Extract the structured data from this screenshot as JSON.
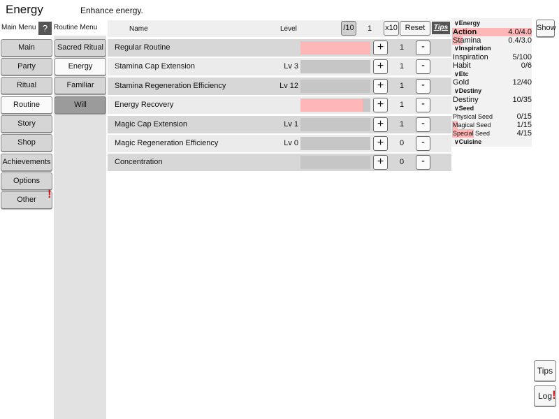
{
  "page": {
    "title": "Energy",
    "description": "Enhance energy."
  },
  "main_menu": {
    "heading": "Main Menu",
    "help": "?",
    "items": [
      {
        "label": "Main"
      },
      {
        "label": "Party"
      },
      {
        "label": "Ritual"
      },
      {
        "label": "Routine"
      },
      {
        "label": "Story"
      },
      {
        "label": "Shop"
      },
      {
        "label": "Achievements"
      },
      {
        "label": "Options"
      },
      {
        "label": "Other"
      }
    ],
    "active": "Routine",
    "alert": "!"
  },
  "routine_menu": {
    "heading": "Routine Menu",
    "items": [
      {
        "label": "Sacred Ritual"
      },
      {
        "label": "Energy"
      },
      {
        "label": "Familiar"
      },
      {
        "label": "Will"
      }
    ]
  },
  "table": {
    "col_name": "Name",
    "col_level": "Level",
    "div10": "/10",
    "multiplier": "1",
    "x10": "x10",
    "reset": "Reset",
    "tips": "Tips",
    "rows": [
      {
        "name": "Regular Routine",
        "level": "",
        "progress": 1.0,
        "plus": "+",
        "count": "1",
        "minus": "-"
      },
      {
        "name": "Stamina Cap Extension",
        "level": "Lv 3",
        "progress": 0,
        "plus": "+",
        "count": "1",
        "minus": "-"
      },
      {
        "name": "Stamina Regeneration Efficiency",
        "level": "Lv 12",
        "progress": 0,
        "plus": "+",
        "count": "1",
        "minus": "-"
      },
      {
        "name": "Energy Recovery",
        "level": "",
        "progress": 0.89,
        "plus": "+",
        "count": "1",
        "minus": "-"
      },
      {
        "name": "Magic Cap Extension",
        "level": "Lv 1",
        "progress": 0,
        "plus": "+",
        "count": "1",
        "minus": "-"
      },
      {
        "name": "Magic Regeneration Efficiency",
        "level": "Lv 0",
        "progress": 0,
        "plus": "+",
        "count": "0",
        "minus": "-"
      },
      {
        "name": "Concentration",
        "level": "",
        "progress": 0,
        "plus": "+",
        "count": "0",
        "minus": "-"
      }
    ]
  },
  "resources": {
    "groups": {
      "energy": "Energy",
      "inspiration": "Inspiration",
      "etc": "Etc",
      "destiny": "Destiny",
      "seed": "Seed",
      "cuisine": "Cuisine"
    },
    "items": {
      "action": {
        "name": "Action",
        "value": "4.0/4.0",
        "fill": 1.0
      },
      "stamina": {
        "name": "Stamina",
        "value": "0.4/3.0",
        "fill": 0.13
      },
      "inspiration": {
        "name": "Inspiration",
        "value": "5/100",
        "fill": 0
      },
      "habit": {
        "name": "Habit",
        "value": "0/6",
        "fill": 0
      },
      "gold": {
        "name": "Gold",
        "value": "12/40",
        "fill": 0
      },
      "destiny": {
        "name": "Destiny",
        "value": "10/35",
        "fill": 0
      },
      "physical_seed": {
        "name": "Physical Seed",
        "value": "0/15",
        "fill": 0
      },
      "magical_seed": {
        "name": "Magical Seed",
        "value": "1/15",
        "fill": 0.07
      },
      "special_seed": {
        "name": "Special Seed",
        "value": "4/15",
        "fill": 0.27
      }
    },
    "caret": "∨"
  },
  "side": {
    "show": "Show",
    "tips": "Tips",
    "log": "Log",
    "log_alert": "!"
  },
  "colors": {
    "progress_fill": "#ffb6b6",
    "help_bg": "#555555",
    "alert": "#dd1111"
  }
}
